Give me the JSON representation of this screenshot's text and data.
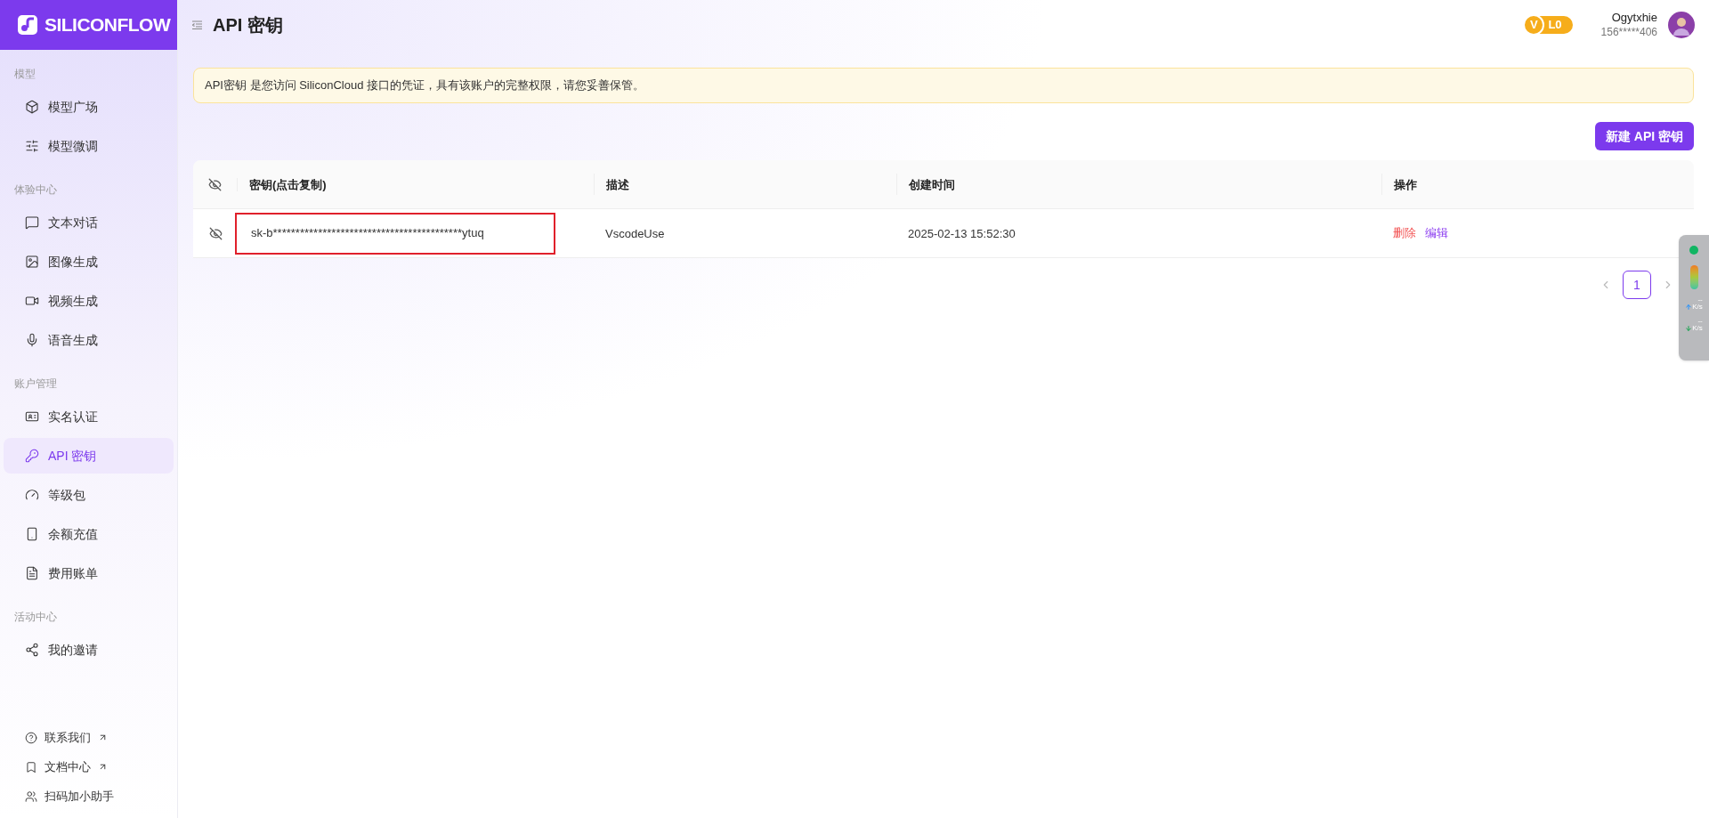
{
  "sidebar": {
    "logo": "SILICONFLOW",
    "groups": [
      {
        "label": "模型",
        "items": [
          {
            "label": "模型广场",
            "selected": false
          },
          {
            "label": "模型微调",
            "selected": false
          }
        ]
      },
      {
        "label": "体验中心",
        "items": [
          {
            "label": "文本对话",
            "selected": false
          },
          {
            "label": "图像生成",
            "selected": false
          },
          {
            "label": "视频生成",
            "selected": false
          },
          {
            "label": "语音生成",
            "selected": false
          }
        ]
      },
      {
        "label": "账户管理",
        "items": [
          {
            "label": "实名认证",
            "selected": false
          },
          {
            "label": "API 密钥",
            "selected": true
          },
          {
            "label": "等级包",
            "selected": false
          },
          {
            "label": "余额充值",
            "selected": false
          },
          {
            "label": "费用账单",
            "selected": false
          }
        ]
      },
      {
        "label": "活动中心",
        "items": [
          {
            "label": "我的邀请",
            "selected": false
          }
        ]
      }
    ],
    "footer_links": [
      {
        "label": "联系我们",
        "external": true
      },
      {
        "label": "文档中心",
        "external": true
      },
      {
        "label": "扫码加小助手",
        "external": false
      }
    ]
  },
  "header": {
    "title": "API 密钥",
    "badge_letter": "V",
    "level": "L0",
    "user": {
      "name": "Ogytxhie",
      "phone": "156*****406"
    }
  },
  "notice": "API密钥 是您访问 SiliconCloud 接口的凭证，具有该账户的完整权限，请您妥善保管。",
  "new_key_button": "新建 API 密钥",
  "table": {
    "columns": [
      "密钥(点击复制)",
      "描述",
      "创建时间",
      "操作"
    ],
    "rows": [
      {
        "key": "sk-b******************************************ytuq",
        "highlighted": true,
        "description": "VscodeUse",
        "created": "2025-02-13 15:52:30",
        "actions": [
          {
            "label": "删除",
            "kind": "danger"
          },
          {
            "label": "编辑",
            "kind": "primary"
          }
        ]
      }
    ]
  },
  "pagination": {
    "pages": [
      {
        "label": "1",
        "selected": true
      }
    ]
  },
  "net_monitor": {
    "upload": {
      "value": "--",
      "unit": "K/s"
    },
    "download": {
      "value": "--",
      "unit": "K/s"
    }
  }
}
